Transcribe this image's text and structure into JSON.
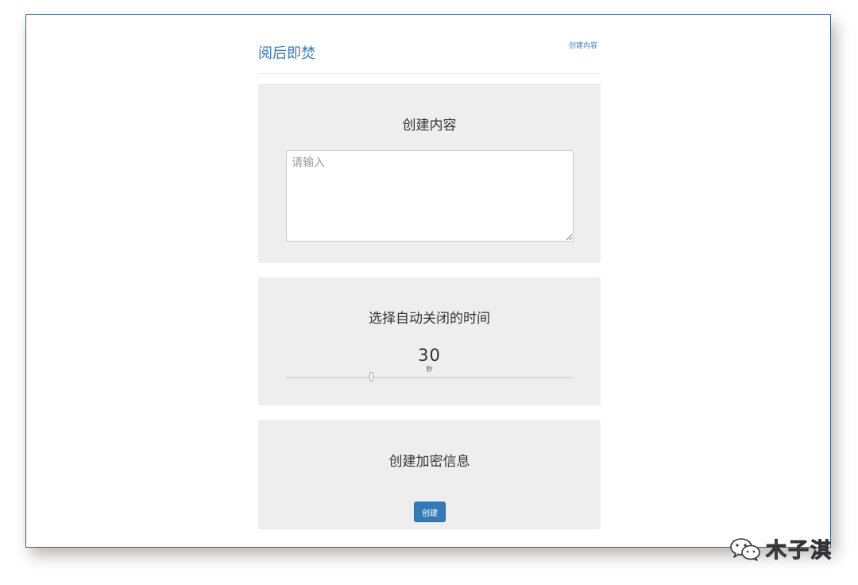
{
  "header": {
    "brand": "阅后即焚",
    "nav_link": "创建内容"
  },
  "content_panel": {
    "title": "创建内容",
    "input_value": "",
    "input_placeholder": "请输入"
  },
  "timer_panel": {
    "title": "选择自动关闭的时间",
    "value": "30",
    "unit": "秒",
    "slider_level": 0.3
  },
  "submit_panel": {
    "title": "创建加密信息",
    "button_label": "创建",
    "button_color": "#337ab7"
  },
  "watermark": {
    "icon": "wechat-icon",
    "text": "木子淇"
  },
  "colors": {
    "brand": "#3a7ab3",
    "panel_bg": "#eeeeee",
    "window_border": "#3d5a80"
  }
}
